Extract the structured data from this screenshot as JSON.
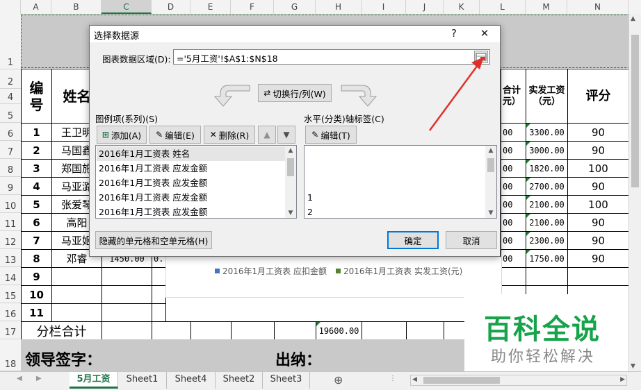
{
  "sheet": {
    "columns": [
      "A",
      "B",
      "C",
      "D",
      "E",
      "F",
      "G",
      "H",
      "I",
      "J",
      "K",
      "L",
      "M",
      "N"
    ],
    "rows": [
      "1",
      "2",
      "4",
      "5",
      "6",
      "7",
      "8",
      "9",
      "10",
      "11",
      "12",
      "13",
      "14",
      "15",
      "16",
      "17",
      "18"
    ],
    "header": {
      "col_a": "编\n号",
      "col_b": "姓名",
      "col_l_part": "合计\n元）",
      "col_m": "实发工资\n（元）",
      "col_n": "评分"
    },
    "data_rows": [
      {
        "num": "1",
        "name": "王卫明",
        "l": "00",
        "m": "3300.00",
        "n": "90"
      },
      {
        "num": "2",
        "name": "马国鑫",
        "l": "00",
        "m": "3000.00",
        "n": "90"
      },
      {
        "num": "3",
        "name": "郑国施",
        "l": "00",
        "m": "1820.00",
        "n": "100"
      },
      {
        "num": "4",
        "name": "马亚潞",
        "l": "00",
        "m": "2700.00",
        "n": "90"
      },
      {
        "num": "5",
        "name": "张爱琴",
        "l": "00",
        "m": "2100.00",
        "n": "100"
      },
      {
        "num": "6",
        "name": "高阳",
        "l": "00",
        "m": "2100.00",
        "n": "90"
      },
      {
        "num": "7",
        "name": "马亚姬",
        "l": "00",
        "m": "2300.00",
        "n": "90"
      },
      {
        "num": "8",
        "name": "邓睿",
        "l": "00",
        "m": "1750.00",
        "n": "90"
      }
    ],
    "row8_c": "1450.00",
    "row8_d": "0.",
    "empty_nums": [
      "9",
      "10",
      "11"
    ],
    "total_label": "分栏合计",
    "total_value": "19600.00",
    "sign_leader": "领导签字：",
    "sign_cashier": "出纳：",
    "legend": [
      "2016年1月工资表 应扣金额",
      "2016年1月工资表 实发工资(元)"
    ],
    "legend_colors": [
      "#4472c4",
      "#548235"
    ],
    "tabs": [
      "5月工资",
      "Sheet1",
      "Sheet4",
      "Sheet2",
      "Sheet3"
    ]
  },
  "dialog": {
    "title": "选择数据源",
    "help": "?",
    "close": "✕",
    "range_label": "图表数据区域(D):",
    "range_value": "='5月工资'!$A$1:$N$18",
    "switch_button": "切换行/列(W)",
    "series_label": "图例项(系列)(S)",
    "axis_label": "水平(分类)轴标签(C)",
    "add_button": "添加(A)",
    "edit_button": "编辑(E)",
    "delete_button": "删除(R)",
    "axis_edit_button": "编辑(T)",
    "series_items": [
      "2016年1月工资表 姓名",
      "2016年1月工资表 应发金额",
      "2016年1月工资表 应发金额",
      "2016年1月工资表 应发金额",
      "2016年1月工资表 应发金额"
    ],
    "axis_items": [
      "",
      "",
      "",
      "1",
      "2"
    ],
    "hidden_cells_button": "隐藏的单元格和空单元格(H)",
    "ok_button": "确定",
    "cancel_button": "取消"
  },
  "watermark": {
    "title": "百科全说",
    "subtitle": "助你轻松解决",
    "color": "#16a34a"
  },
  "annotation_color": "#e0302a"
}
